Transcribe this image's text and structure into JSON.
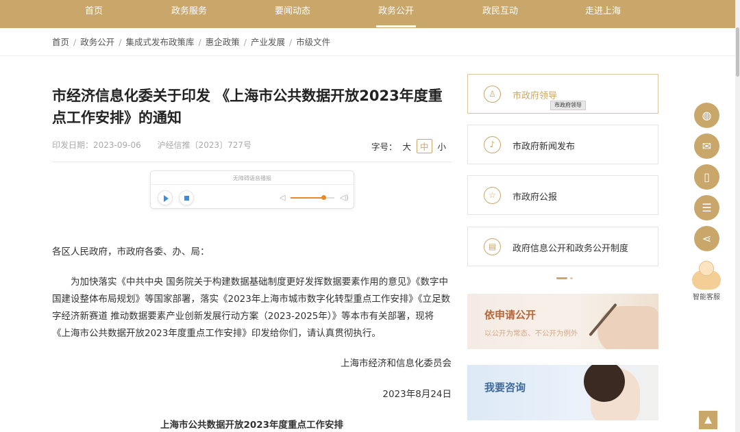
{
  "nav": {
    "items": [
      {
        "label": "首页",
        "active": false
      },
      {
        "label": "政务服务",
        "active": false
      },
      {
        "label": "要闻动态",
        "active": false
      },
      {
        "label": "政务公开",
        "active": true
      },
      {
        "label": "政民互动",
        "active": false
      },
      {
        "label": "走进上海",
        "active": false
      }
    ]
  },
  "breadcrumb": {
    "items": [
      "首页",
      "政务公开",
      "集成式发布政策库",
      "惠企政策",
      "产业发展",
      "市级文件"
    ],
    "separator": "/"
  },
  "article": {
    "title": "市经济信息化委关于印发 《上海市公共数据开放2023年度重点工作安排》的通知",
    "date_label": "印发日期：",
    "date": "2023-09-06",
    "doc_number": "沪经信推〔2023〕727号",
    "font_size": {
      "label": "字号：",
      "options": [
        "大",
        "中",
        "小"
      ],
      "selected": "中"
    },
    "greeting": "各区人民政府，市政府各委、办、局：",
    "paragraph": "为加快落实《中共中央 国务院关于构建数据基础制度更好发挥数据要素作用的意见》《数字中国建设整体布局规划》等国家部署，落实《2023年上海市城市数字化转型重点工作安排》《立足数字经济新赛道 推动数据要素产业创新发展行动方案（2023-2025年）》等本市有关部署，现将《上海市公共数据开放2023年度重点工作安排》印发给你们，请认真贯彻执行。",
    "signer": "上海市经济和信息化委员会",
    "sign_date": "2023年8月24日",
    "attachment_title": "上海市公共数据开放2023年度重点工作安排"
  },
  "player": {
    "title": "无障碍语音播报",
    "volume": 0.75
  },
  "sidebar": {
    "links": [
      {
        "label": "市政府领导",
        "icon": "person-icon",
        "glyph": "♙"
      },
      {
        "label": "市政府新闻发布",
        "icon": "microphone-icon",
        "glyph": "🎙"
      },
      {
        "label": "市政府公报",
        "icon": "star-icon",
        "glyph": "☆"
      },
      {
        "label": "政府信息公开和政务公开制度",
        "icon": "document-icon",
        "glyph": "▤"
      }
    ],
    "tooltip": "市政府领导",
    "banners": [
      {
        "title": "依申请公开",
        "subtitle": "以公开为常态、不公开为例外"
      },
      {
        "title": "我要咨询",
        "subtitle": ""
      }
    ]
  },
  "floating": {
    "buttons": [
      {
        "name": "wechat-icon",
        "glyph": "◍"
      },
      {
        "name": "mail-icon",
        "glyph": "✉"
      },
      {
        "name": "mobile-icon",
        "glyph": "▯"
      },
      {
        "name": "rss-icon",
        "glyph": "☰"
      },
      {
        "name": "share-icon",
        "glyph": "⋖"
      }
    ],
    "assistant_label": "智能客服",
    "top_glyph": "▲"
  },
  "colors": {
    "accent": "#c9a76a",
    "player_blue": "#3a8de0",
    "volume_orange": "#e88a2c"
  }
}
